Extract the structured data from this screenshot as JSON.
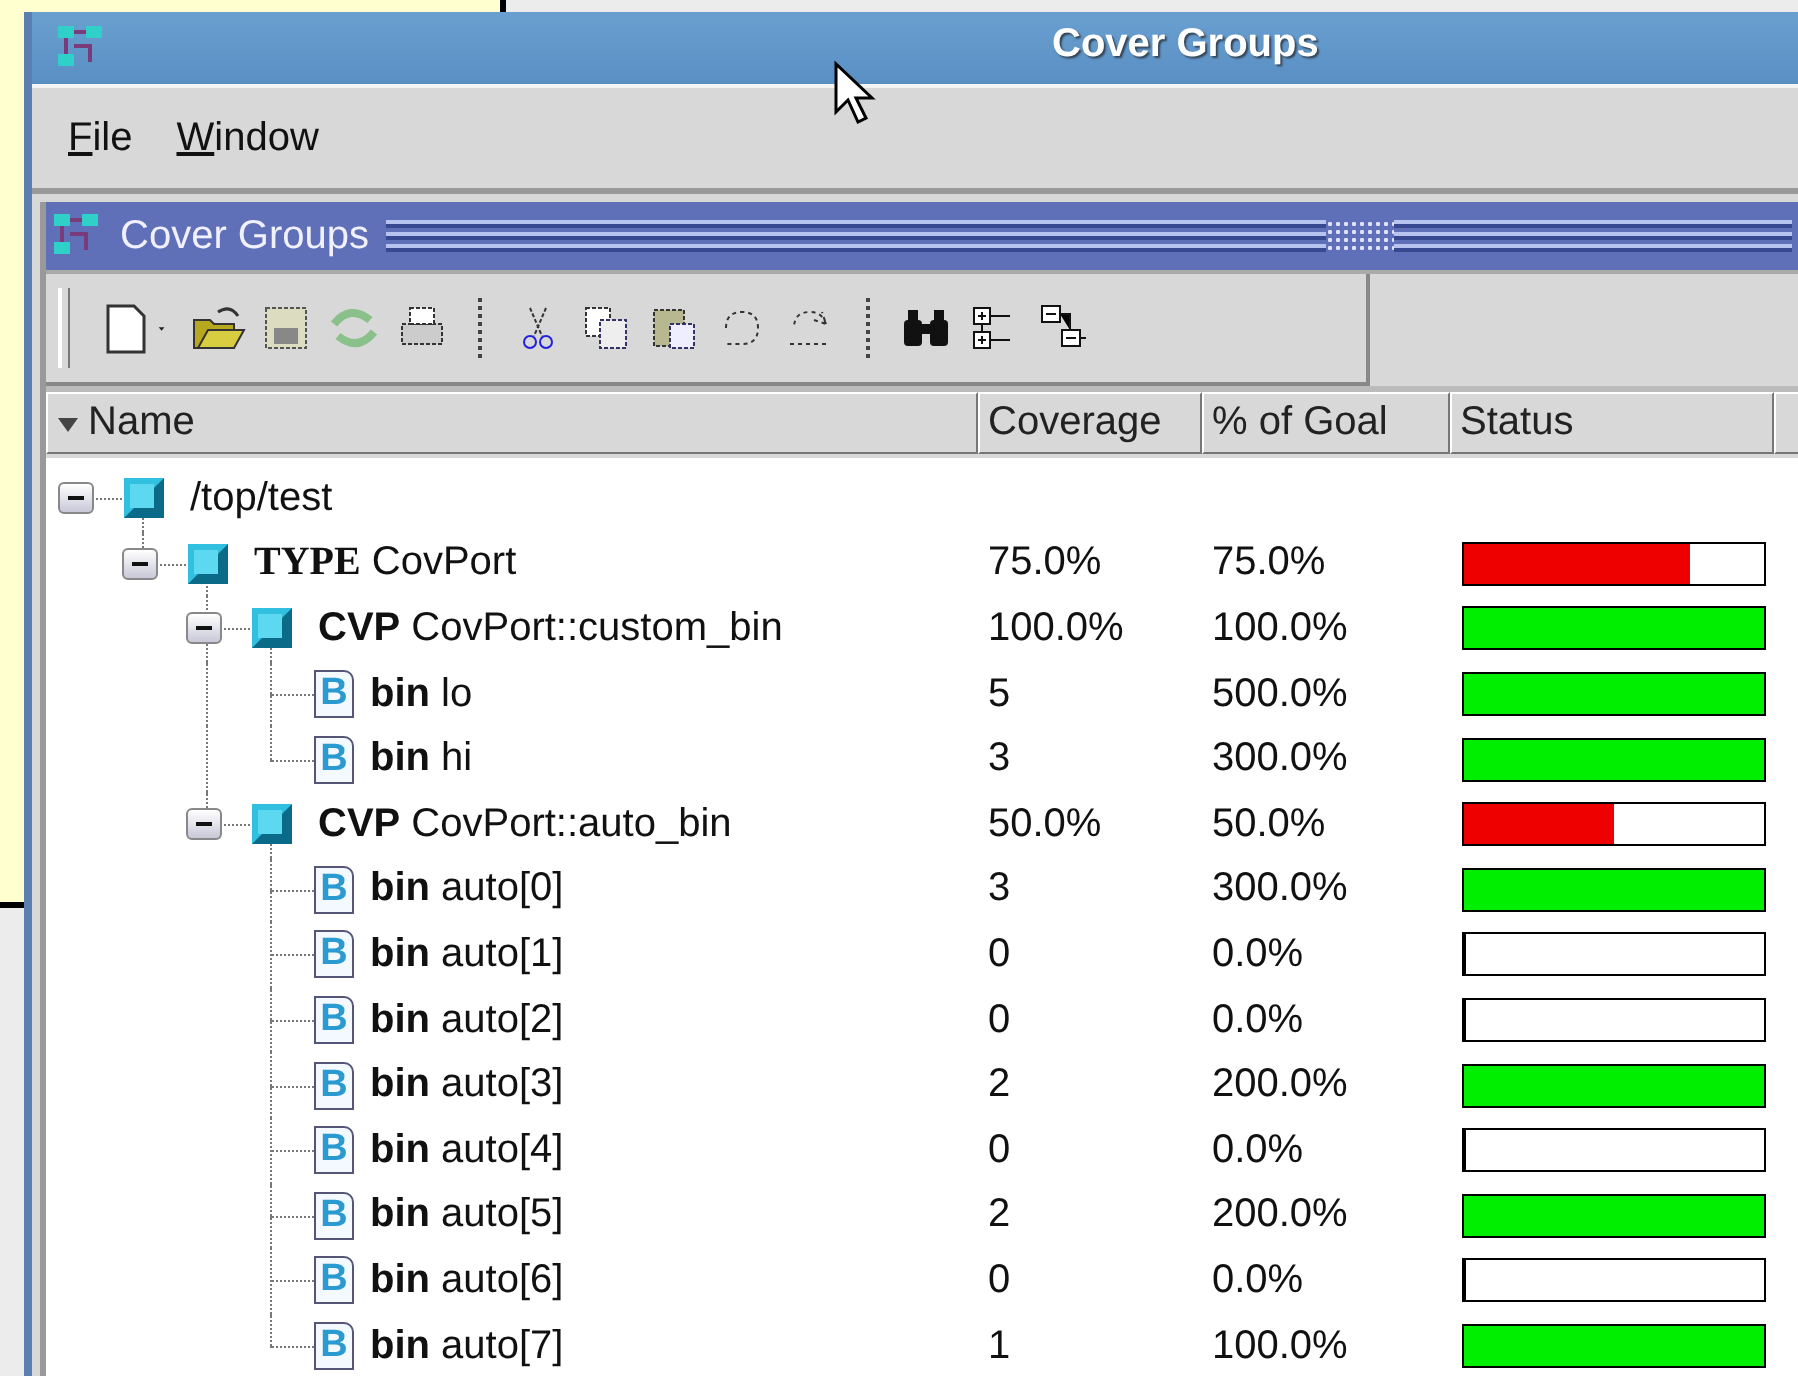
{
  "window": {
    "title": "Cover Groups"
  },
  "menu": [
    {
      "label": "File"
    },
    {
      "label": "Window"
    }
  ],
  "panel": {
    "title": "Cover Groups"
  },
  "table": {
    "columns": [
      "Name",
      "Coverage",
      "% of Goal",
      "Status"
    ],
    "rows": [
      {
        "kind": "scope",
        "name": "/top/test",
        "expanded": true,
        "children": [
          {
            "kind": "type",
            "tag": "TYPE",
            "name": "CovPort",
            "coverage": "75.0%",
            "goal": "75.0%",
            "level": 0.75,
            "expanded": true,
            "children": [
              {
                "kind": "cvp",
                "tag": "CVP",
                "name": "CovPort::custom_bin",
                "coverage": "100.0%",
                "goal": "100.0%",
                "level": 1,
                "expanded": true,
                "children": [
                  {
                    "kind": "bin",
                    "icon": "B",
                    "tag": "bin",
                    "name": "lo",
                    "coverage": "5",
                    "goal": "500.0%",
                    "level": 1
                  },
                  {
                    "kind": "bin",
                    "icon": "B",
                    "tag": "bin",
                    "name": "hi",
                    "coverage": "3",
                    "goal": "300.0%",
                    "level": 1
                  }
                ]
              },
              {
                "kind": "cvp",
                "tag": "CVP",
                "name": "CovPort::auto_bin",
                "coverage": "50.0%",
                "goal": "50.0%",
                "level": 0.5,
                "expanded": true,
                "children": [
                  {
                    "kind": "bin",
                    "icon": "B",
                    "tag": "bin",
                    "name": "auto[0]",
                    "coverage": "3",
                    "goal": "300.0%",
                    "level": 1
                  },
                  {
                    "kind": "bin",
                    "icon": "B",
                    "tag": "bin",
                    "name": "auto[1]",
                    "coverage": "0",
                    "goal": "0.0%",
                    "level": 0
                  },
                  {
                    "kind": "bin",
                    "icon": "B",
                    "tag": "bin",
                    "name": "auto[2]",
                    "coverage": "0",
                    "goal": "0.0%",
                    "level": 0
                  },
                  {
                    "kind": "bin",
                    "icon": "B",
                    "tag": "bin",
                    "name": "auto[3]",
                    "coverage": "2",
                    "goal": "200.0%",
                    "level": 1
                  },
                  {
                    "kind": "bin",
                    "icon": "B",
                    "tag": "bin",
                    "name": "auto[4]",
                    "coverage": "0",
                    "goal": "0.0%",
                    "level": 0
                  },
                  {
                    "kind": "bin",
                    "icon": "B",
                    "tag": "bin",
                    "name": "auto[5]",
                    "coverage": "2",
                    "goal": "200.0%",
                    "level": 1
                  },
                  {
                    "kind": "bin",
                    "icon": "B",
                    "tag": "bin",
                    "name": "auto[6]",
                    "coverage": "0",
                    "goal": "0.0%",
                    "level": 0
                  },
                  {
                    "kind": "bin",
                    "icon": "B",
                    "tag": "bin",
                    "name": "auto[7]",
                    "coverage": "1",
                    "goal": "100.0%",
                    "level": 1
                  }
                ]
              }
            ]
          }
        ]
      }
    ]
  }
}
